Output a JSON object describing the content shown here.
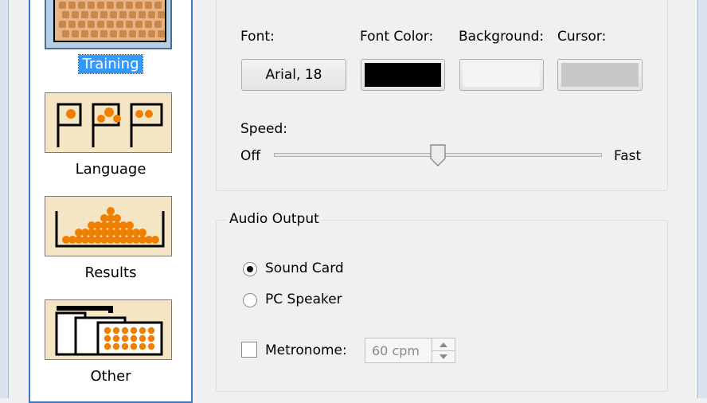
{
  "sidebar": {
    "items": [
      {
        "label": "Training",
        "selected": true
      },
      {
        "label": "Language",
        "selected": false
      },
      {
        "label": "Results",
        "selected": false
      },
      {
        "label": "Other",
        "selected": false
      }
    ]
  },
  "display": {
    "font_label": "Font:",
    "font_value": "Arial, 18",
    "font_color_label": "Font Color:",
    "font_color": "#000000",
    "background_label": "Background:",
    "background_color": "#f4f4f4",
    "cursor_label": "Cursor:",
    "cursor_color": "#c8c8c8",
    "speed_label": "Speed:",
    "speed_min_label": "Off",
    "speed_max_label": "Fast",
    "speed_level": 0.5
  },
  "audio": {
    "legend": "Audio Output",
    "options": [
      {
        "label": "Sound Card",
        "checked": true
      },
      {
        "label": "PC Speaker",
        "checked": false
      }
    ],
    "metronome_label": "Metronome:",
    "metronome_checked": false,
    "metronome_value": "60 cpm"
  },
  "colors": {
    "accent": "#3399ff",
    "icon_orange": "#f07f00",
    "icon_bg": "#f4e6c4"
  }
}
